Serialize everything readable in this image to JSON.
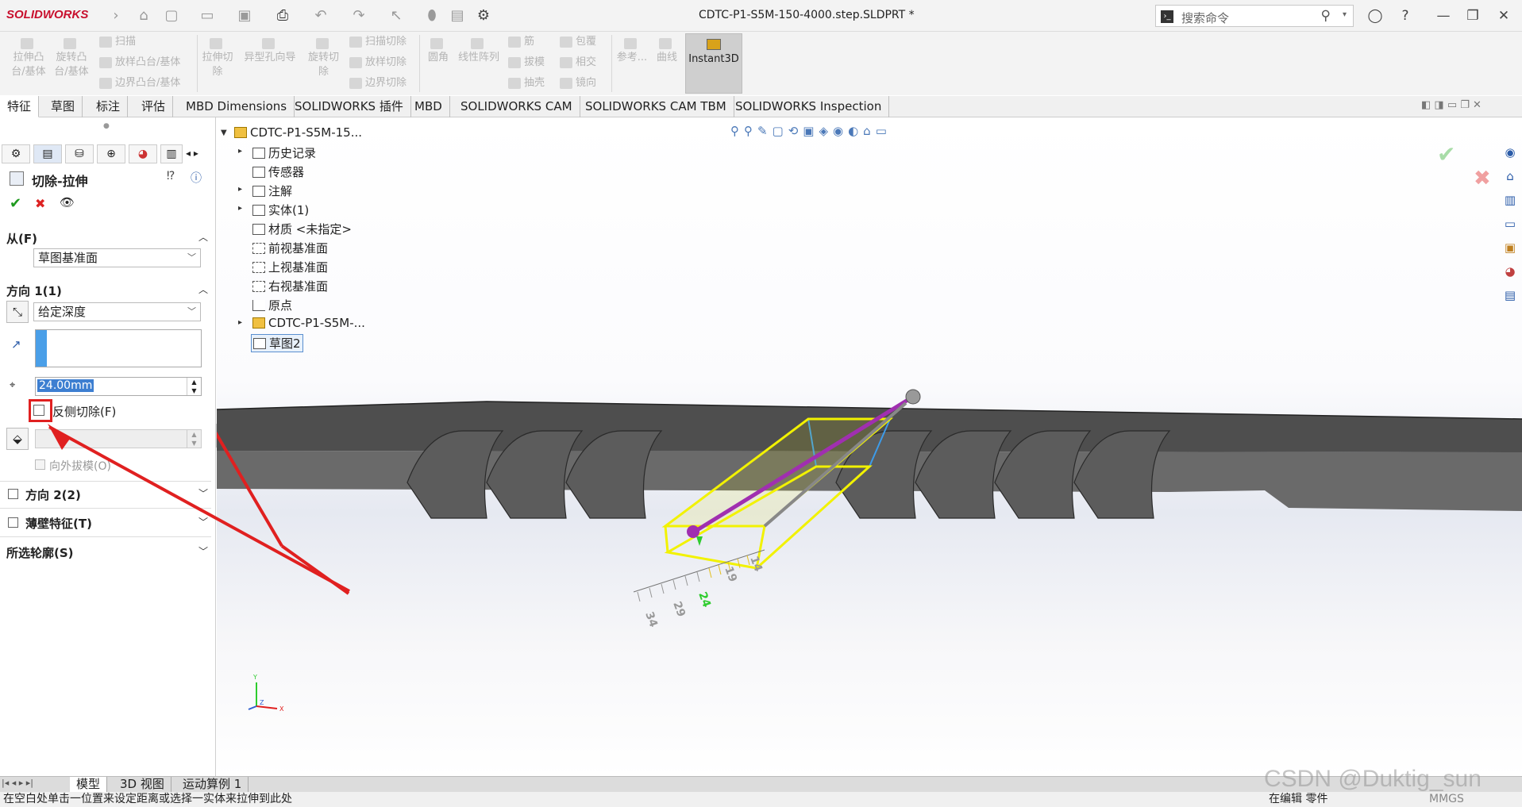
{
  "app": {
    "logo": "SOLIDWORKS",
    "doc_title": "CDTC-P1-S5M-150-4000.step.SLDPRT *",
    "search_placeholder": "搜索命令"
  },
  "ribbon": {
    "groups": [
      {
        "label": "拉伸凸台/基体"
      },
      {
        "label": "旋转凸台/基体"
      }
    ],
    "small": [
      "扫描",
      "放样凸台/基体",
      "边界凸台/基体",
      "拉伸切除",
      "异型孔向导",
      "旋转切除",
      "扫描切除",
      "放样切除",
      "边界切除",
      "圆角",
      "线性阵列",
      "筋",
      "拔模",
      "抽壳",
      "包覆",
      "相交",
      "镜向",
      "参考...",
      "曲线"
    ],
    "instant3d": "Instant3D"
  },
  "tabs": [
    "特征",
    "草图",
    "标注",
    "评估",
    "MBD Dimensions",
    "SOLIDWORKS 插件",
    "MBD",
    "SOLIDWORKS CAM",
    "SOLIDWORKS CAM TBM",
    "SOLIDWORKS Inspection"
  ],
  "panel": {
    "title": "切除-拉伸",
    "from_label": "从(F)",
    "from_value": "草图基准面",
    "dir1_label": "方向 1(1)",
    "dir1_value": "给定深度",
    "depth": "24.00mm",
    "flip_label": "反侧切除(F)",
    "draft_label": "向外拔模(O)",
    "dir2_label": "方向 2(2)",
    "thin_label": "薄壁特征(T)",
    "contours_label": "所选轮廓(S)"
  },
  "tree": {
    "root": "CDTC-P1-S5M-15...",
    "items": [
      "历史记录",
      "传感器",
      "注解",
      "实体(1)",
      "材质 <未指定>",
      "前视基准面",
      "上视基准面",
      "右视基准面",
      "原点",
      "CDTC-P1-S5M-...",
      "草图2"
    ]
  },
  "ruler_labels": [
    "34",
    "29",
    "24",
    "19",
    "14"
  ],
  "bottom_tabs": [
    "模型",
    "3D 视图",
    "运动算例 1"
  ],
  "status": {
    "left": "在空白处单击一位置来设定距离或选择一实体来拉伸到此处",
    "right1": "在编辑 零件",
    "right2": "MMGS"
  },
  "watermark": "CSDN @Duktig_sun",
  "colors": {
    "accent_red": "#e02020",
    "highlight": "#f2f200",
    "select_blue": "#3d9be9"
  }
}
